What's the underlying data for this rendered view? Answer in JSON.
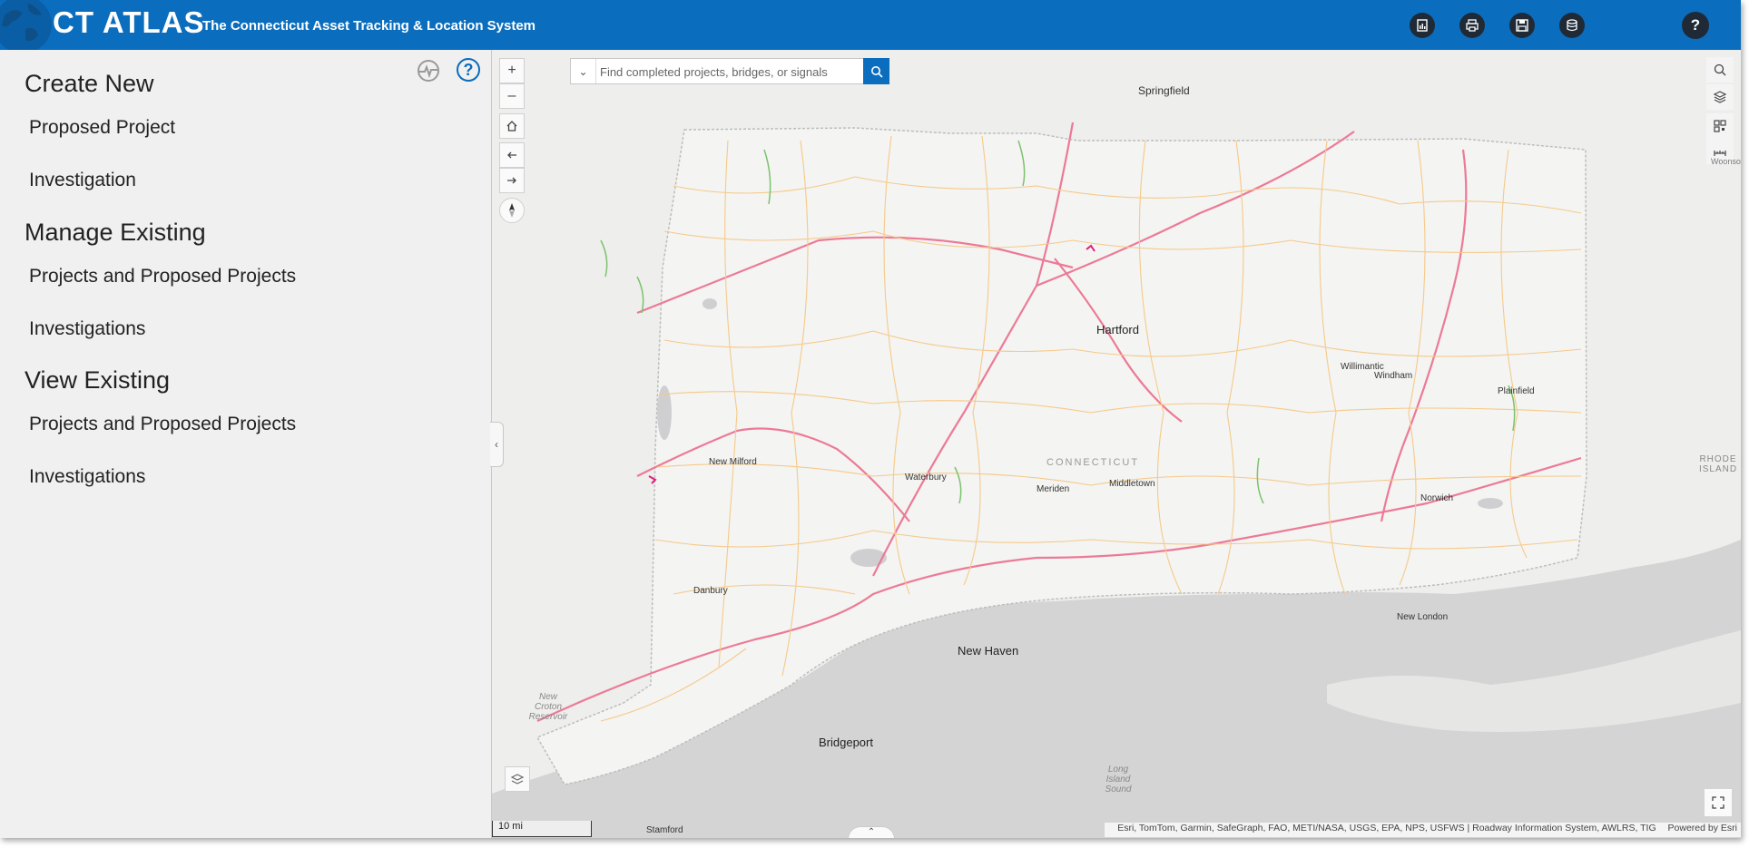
{
  "header": {
    "title": "CT ATLAS",
    "subtitle": "The Connecticut Asset Tracking & Location System",
    "buttons": [
      "report-icon",
      "print-icon",
      "save-icon",
      "database-icon"
    ],
    "help_label": "?",
    "accent_color": "#0b6dbd"
  },
  "sidebar": {
    "create_new": {
      "title": "Create New",
      "items": [
        "Proposed Project",
        "Investigation"
      ]
    },
    "manage_existing": {
      "title": "Manage Existing",
      "items": [
        "Projects and Proposed Projects",
        "Investigations"
      ]
    },
    "view_existing": {
      "title": "View Existing",
      "items": [
        "Projects and Proposed Projects",
        "Investigations"
      ]
    },
    "help_label": "?"
  },
  "map": {
    "search_placeholder": "Find completed projects, bridges, or signals",
    "zoom_in": "+",
    "zoom_out": "–",
    "cities": {
      "springfield": "Springfield",
      "hartford": "Hartford",
      "new_milford": "New Milford",
      "waterbury": "Waterbury",
      "meriden": "Meriden",
      "middletown": "Middletown",
      "willimantic": "Willimantic",
      "windham": "Windham",
      "plainfield": "Plainfield",
      "norwich": "Norwich",
      "danbury": "Danbury",
      "new_haven": "New Haven",
      "new_london": "New London",
      "bridgeport": "Bridgeport",
      "stamford": "Stamford",
      "woonsocket": "Woonso"
    },
    "state_label": "CONNECTICUT",
    "rhode_island": "RHODE ISLAND",
    "water_croton": "New Croton Reservoir",
    "water_lis": "Long Island Sound",
    "scale": "10 mi",
    "attribution": "Esri, TomTom, Garmin, SafeGraph, FAO, METI/NASA, USGS, EPA, NPS, USFWS | Roadway Information System, AWLRS, TIG",
    "powered_by": "Powered by Esri"
  }
}
